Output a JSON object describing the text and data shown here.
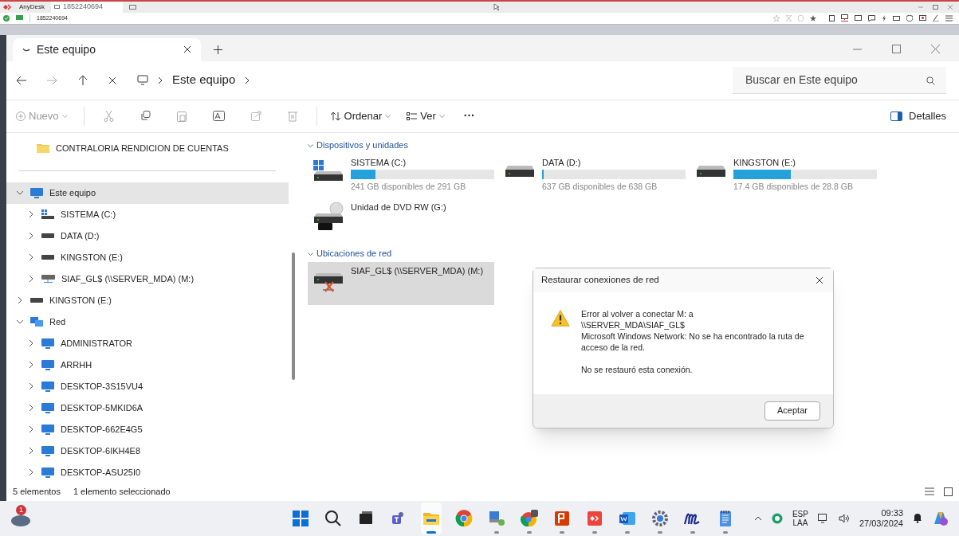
{
  "anydesk": {
    "app_name": "AnyDesk",
    "tab_label": "1852240694",
    "address": "1852240694"
  },
  "explorer": {
    "tab_title": "Este equipo",
    "breadcrumb": "Este equipo",
    "search_placeholder": "Buscar en Este equipo",
    "toolbar": {
      "new_label": "Nuevo",
      "sort_label": "Ordenar",
      "view_label": "Ver",
      "more": "···",
      "details_label": "Detalles"
    },
    "sidebar": [
      {
        "label": "CONTRALORIA RENDICION DE CUENTAS",
        "kind": "folder",
        "selected": false
      },
      {
        "label": "Este equipo",
        "kind": "pc",
        "selected": true,
        "expanded": true,
        "children": [
          {
            "label": "SISTEMA (C:)",
            "kind": "system-drive",
            "selected": false,
            "expanded": false
          },
          {
            "label": "DATA (D:)",
            "kind": "drive",
            "selected": false,
            "expanded": false
          },
          {
            "label": "KINGSTON (E:)",
            "kind": "drive",
            "selected": false,
            "expanded": false
          },
          {
            "label": "SIAF_GL$ (\\\\SERVER_MDA) (M:)",
            "kind": "network-drive",
            "selected": false,
            "expanded": false
          }
        ]
      },
      {
        "label": "KINGSTON (E:)",
        "kind": "drive",
        "selected": false,
        "expanded": false
      },
      {
        "label": "Red",
        "kind": "network",
        "selected": false,
        "expanded": true,
        "children": [
          {
            "label": "ADMINISTRATOR",
            "kind": "computer",
            "selected": false,
            "expanded": false
          },
          {
            "label": "ARRHH",
            "kind": "computer",
            "selected": false,
            "expanded": false
          },
          {
            "label": "DESKTOP-3S15VU4",
            "kind": "computer",
            "selected": false,
            "expanded": false
          },
          {
            "label": "DESKTOP-5MKID6A",
            "kind": "computer",
            "selected": false,
            "expanded": false
          },
          {
            "label": "DESKTOP-662E4G5",
            "kind": "computer",
            "selected": false,
            "expanded": false
          },
          {
            "label": "DESKTOP-6IKH4E8",
            "kind": "computer",
            "selected": false,
            "expanded": false
          },
          {
            "label": "DESKTOP-ASU25I0",
            "kind": "computer",
            "selected": false,
            "expanded": false
          }
        ]
      }
    ],
    "sections": [
      {
        "title": "Dispositivos y unidades",
        "expanded": true,
        "items": [
          {
            "kind": "system-drive",
            "name": "SISTEMA (C:)",
            "free": "241 GB disponibles de 291 GB",
            "level": 0.17,
            "selected": false
          },
          {
            "kind": "drive",
            "name": "DATA (D:)",
            "free": "637 GB disponibles de 638 GB",
            "level": 0.01,
            "selected": false
          },
          {
            "kind": "drive",
            "name": "KINGSTON (E:)",
            "free": "17.4 GB disponibles de 28.8 GB",
            "level": 0.4,
            "selected": false
          },
          {
            "kind": "dvd",
            "name": "Unidad de DVD RW (G:)",
            "selected": false
          }
        ]
      },
      {
        "title": "Ubicaciones de red",
        "expanded": true,
        "items": [
          {
            "kind": "network-drive",
            "name": "SIAF_GL$ (\\\\SERVER_MDA) (M:)",
            "selected": true
          }
        ]
      }
    ],
    "status_bar": {
      "count": "5 elementos",
      "selection": "1 elemento seleccionado"
    }
  },
  "dialog": {
    "title": "Restaurar conexiones de red",
    "message": [
      "Error al volver a conectar M: a",
      "\\\\SERVER_MDA\\SIAF_GL$",
      "Microsoft Windows Network: No se ha encontrado la ruta de acceso de la red."
    ],
    "note": "No se restauró esta conexión.",
    "button": "Aceptar"
  },
  "taskbar": {
    "weather_badge": "1",
    "apps": [
      {
        "kind": "start",
        "running": false,
        "selected": false
      },
      {
        "kind": "search",
        "running": false,
        "selected": false
      },
      {
        "kind": "taskview",
        "running": false,
        "selected": false
      },
      {
        "kind": "chat",
        "running": false,
        "selected": false
      },
      {
        "kind": "explorer",
        "running": true,
        "selected": true
      },
      {
        "kind": "browser",
        "running": false,
        "selected": false
      },
      {
        "kind": "network-app",
        "running": true,
        "selected": false
      },
      {
        "kind": "browser-alt",
        "running": true,
        "selected": false
      },
      {
        "kind": "red-app",
        "running": true,
        "selected": false
      },
      {
        "kind": "remote",
        "running": true,
        "selected": false
      },
      {
        "kind": "word",
        "running": true,
        "selected": false
      },
      {
        "kind": "gear",
        "running": true,
        "selected": false
      },
      {
        "kind": "m-app",
        "running": true,
        "selected": false
      },
      {
        "kind": "notepad",
        "running": true,
        "selected": false
      }
    ],
    "language": "ESP",
    "layout": "LAA",
    "time": "09:33",
    "date": "27/03/2024"
  }
}
